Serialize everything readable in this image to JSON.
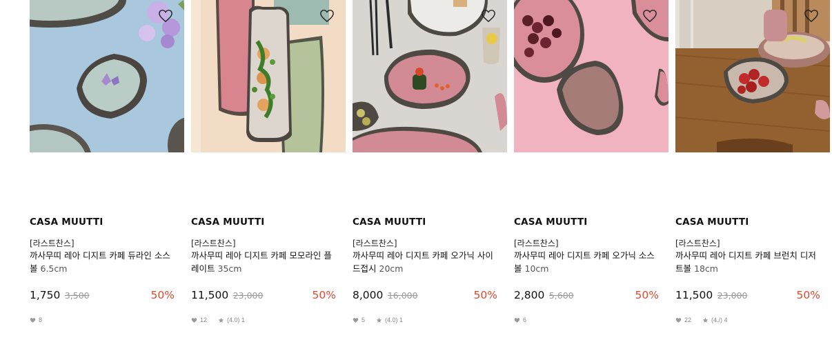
{
  "colors": {
    "accent": "#e8462a",
    "text": "#111111",
    "muted": "#999999"
  },
  "products": [
    {
      "image_desc_icon": "wishlist-heart-icon",
      "brand": "CASA MUUTTI",
      "tag": "[라스트찬스]",
      "name": "까사무띠 레아 디지트 카페 듀라인 소스볼",
      "size": "6.5cm",
      "price": "1,750",
      "original_price": "3,500",
      "discount": "50%",
      "likes": "8",
      "rating": ""
    },
    {
      "image_desc_icon": "wishlist-heart-icon",
      "brand": "CASA MUUTTI",
      "tag": "[라스트찬스]",
      "name": "까사무띠 레아 디지트 카페 모모라인 플레이트",
      "size": "35cm",
      "price": "11,500",
      "original_price": "23,000",
      "discount": "50%",
      "likes": "12",
      "rating": "(4.0) 1"
    },
    {
      "image_desc_icon": "wishlist-heart-icon",
      "brand": "CASA MUUTTI",
      "tag": "[라스트찬스]",
      "name": "까사무띠 레아 디지트 카페 오가닉 사이드접시",
      "size": "20cm",
      "price": "8,000",
      "original_price": "16,000",
      "discount": "50%",
      "likes": "5",
      "rating": "(4.0) 1"
    },
    {
      "image_desc_icon": "wishlist-heart-icon",
      "brand": "CASA MUUTTI",
      "tag": "[라스트찬스]",
      "name": "까사무띠 레아 디지트 카페 오가닉 소스볼",
      "size": "10cm",
      "price": "2,800",
      "original_price": "5,600",
      "discount": "50%",
      "likes": "6",
      "rating": ""
    },
    {
      "image_desc_icon": "wishlist-heart-icon",
      "brand": "CASA MUUTTI",
      "tag": "[라스트찬스]",
      "name": "까사무띠 레아 디지트 카페 브런치 디저트볼",
      "size": "18cm",
      "price": "11,500",
      "original_price": "23,000",
      "discount": "50%",
      "likes": "22",
      "rating": "(4./) 4"
    }
  ]
}
